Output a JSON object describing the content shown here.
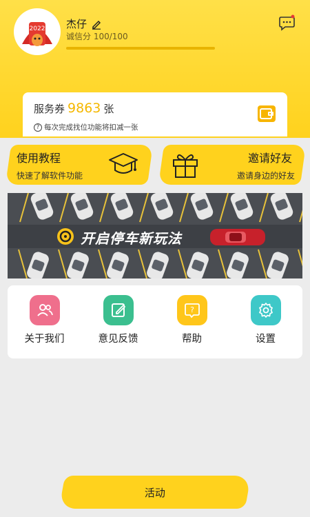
{
  "profile": {
    "username": "杰仔",
    "credit_label": "诚信分 100/100",
    "credit_progress": 1.0,
    "avatar_text": "2022"
  },
  "coupon": {
    "label": "服务券",
    "count": "9863",
    "unit": "张",
    "note": "每次完成找位功能将扣减一张",
    "note_icon": "?"
  },
  "promos": [
    {
      "title": "使用教程",
      "subtitle": "快速了解软件功能",
      "icon": "graduation-cap-icon"
    },
    {
      "title": "邀请好友",
      "subtitle": "邀请身边的好友",
      "icon": "gift-icon"
    }
  ],
  "banner": {
    "text": "开启停车新玩法",
    "icon": "steering-wheel-icon"
  },
  "menu": [
    {
      "label": "关于我们",
      "icon": "people-icon",
      "color": "#ef6f8c"
    },
    {
      "label": "意见反馈",
      "icon": "edit-icon",
      "color": "#3bbf8f"
    },
    {
      "label": "帮助",
      "icon": "help-icon",
      "color": "#ffc61a"
    },
    {
      "label": "设置",
      "icon": "gear-icon",
      "color": "#3ec8c8"
    }
  ],
  "activity_button": {
    "label": "活动"
  },
  "colors": {
    "brand_yellow": "#ffd21d",
    "accent_count": "#f5b800"
  }
}
